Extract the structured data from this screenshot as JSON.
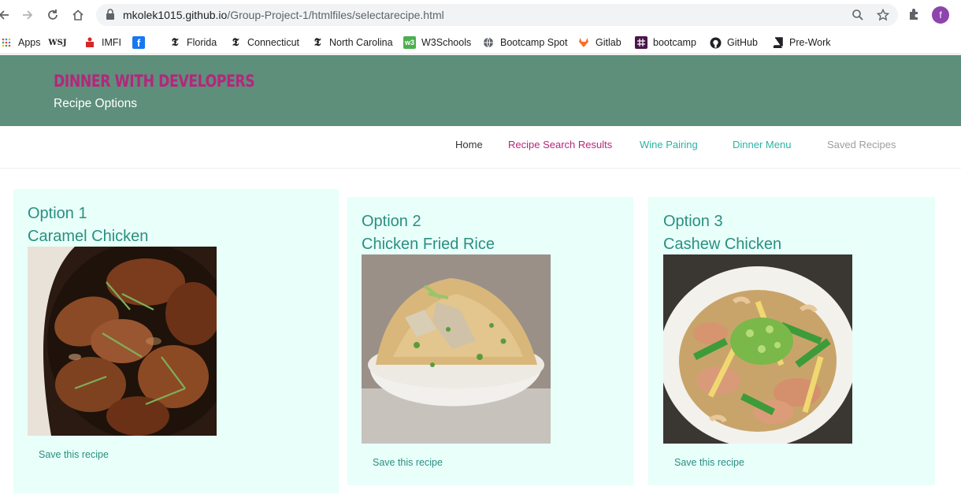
{
  "browser": {
    "url_host": "mkolek1015.github.io",
    "url_path": "/Group-Project-1/htmlfiles/selectarecipe.html",
    "profile_initial": "f",
    "icons": [
      "back-icon",
      "forward-icon",
      "reload-icon",
      "home-icon",
      "lock-icon",
      "zoom-icon",
      "star-icon",
      "extensions-icon"
    ]
  },
  "bookmarks": [
    {
      "label": "Apps",
      "icon": "apps-grid-icon"
    },
    {
      "label": "",
      "icon": "wsj-icon",
      "icon_text": "WSJ"
    },
    {
      "label": "IMFI",
      "icon": "imfi-icon"
    },
    {
      "label": "",
      "icon": "facebook-icon",
      "icon_text": "f"
    },
    {
      "label": "Florida",
      "icon": "nyt-icon"
    },
    {
      "label": "Connecticut",
      "icon": "nyt-icon"
    },
    {
      "label": "North Carolina",
      "icon": "nyt-icon"
    },
    {
      "label": "W3Schools",
      "icon": "w3schools-icon",
      "icon_text": "w3"
    },
    {
      "label": "Bootcamp Spot",
      "icon": "globe-icon"
    },
    {
      "label": "Gitlab",
      "icon": "gitlab-icon"
    },
    {
      "label": "bootcamp",
      "icon": "slack-icon"
    },
    {
      "label": "GitHub",
      "icon": "github-icon"
    },
    {
      "label": "Pre-Work",
      "icon": "book-icon"
    }
  ],
  "site": {
    "title": "DINNER WITH DEVELOPERS",
    "subtitle": "Recipe Options"
  },
  "nav": [
    {
      "label": "Home",
      "color": "#333333"
    },
    {
      "label": "Recipe Search Results",
      "color": "#b5267c"
    },
    {
      "label": "Wine Pairing",
      "color": "#2ab3a3"
    },
    {
      "label": "Dinner Menu",
      "color": "#2ab3a3"
    },
    {
      "label": "Saved Recipes",
      "color": "#9e9e9e"
    }
  ],
  "cards": [
    {
      "option": "Option 1",
      "name": "Caramel Chicken",
      "save_label": "Save this recipe",
      "image": "caramel-chicken-photo"
    },
    {
      "option": "Option 2",
      "name": "Chicken Fried Rice",
      "save_label": "Save this recipe",
      "image": "chicken-fried-rice-photo"
    },
    {
      "option": "Option 3",
      "name": "Cashew Chicken",
      "save_label": "Save this recipe",
      "image": "cashew-chicken-photo"
    }
  ],
  "colors": {
    "header_bg": "#5d8f7b",
    "title": "#b5267c",
    "card_bg": "#e8fffa",
    "card_text": "#2a8f80"
  }
}
